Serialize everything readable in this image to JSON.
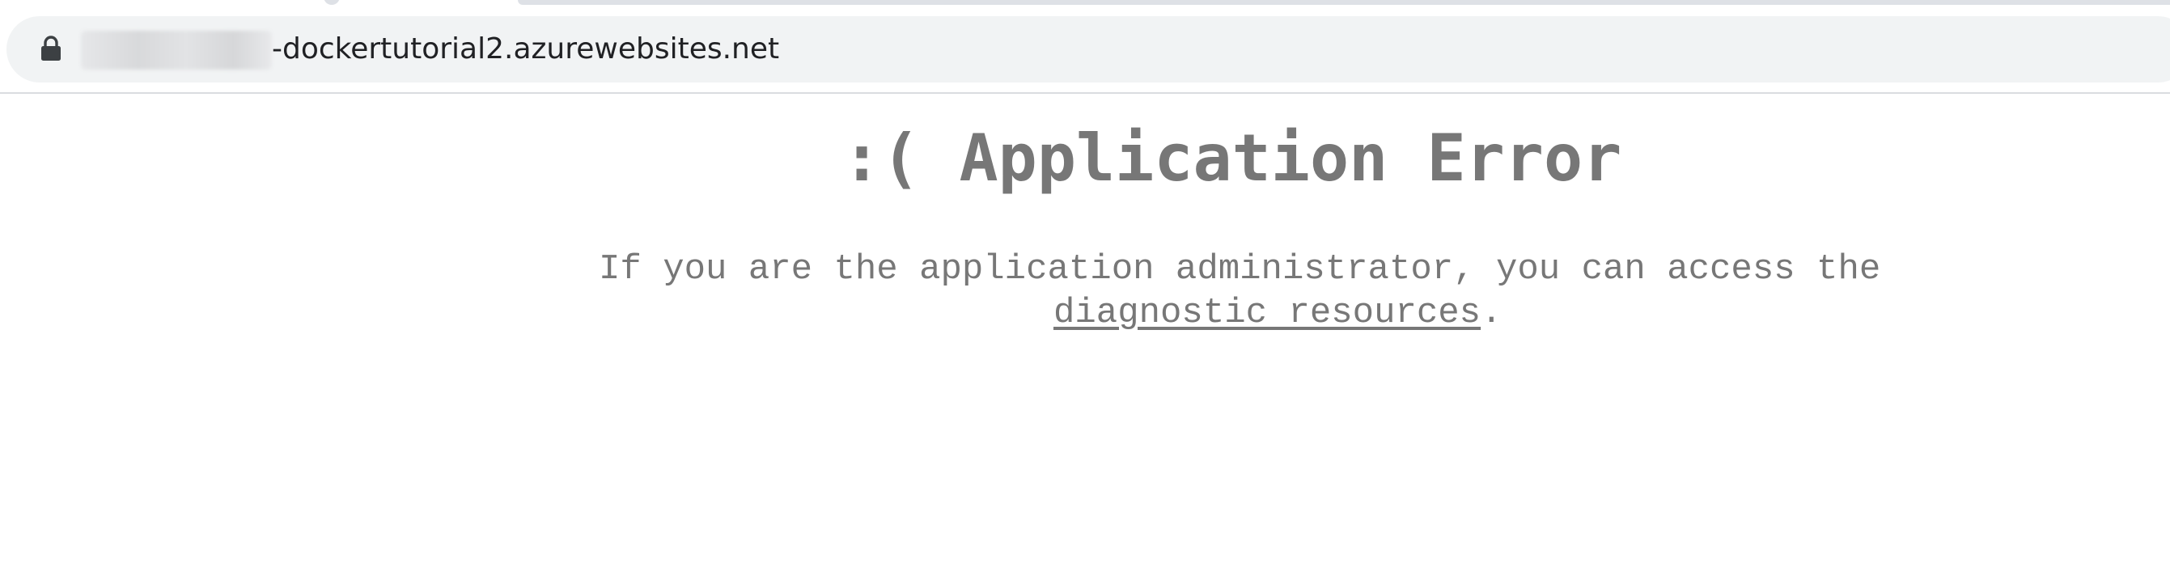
{
  "browser": {
    "url_prefix_hidden": "",
    "url_visible": "-dockertutorial2.azurewebsites.net",
    "icons": {
      "lock": "lock-icon"
    },
    "colors": {
      "omnibox_bg": "#f1f3f4",
      "url_text": "#202124",
      "page_text": "#777777"
    }
  },
  "page": {
    "title": ":( Application Error",
    "message_line1": "If you are the application administrator, you can access the",
    "link_text": "diagnostic resources",
    "message_end": "."
  }
}
